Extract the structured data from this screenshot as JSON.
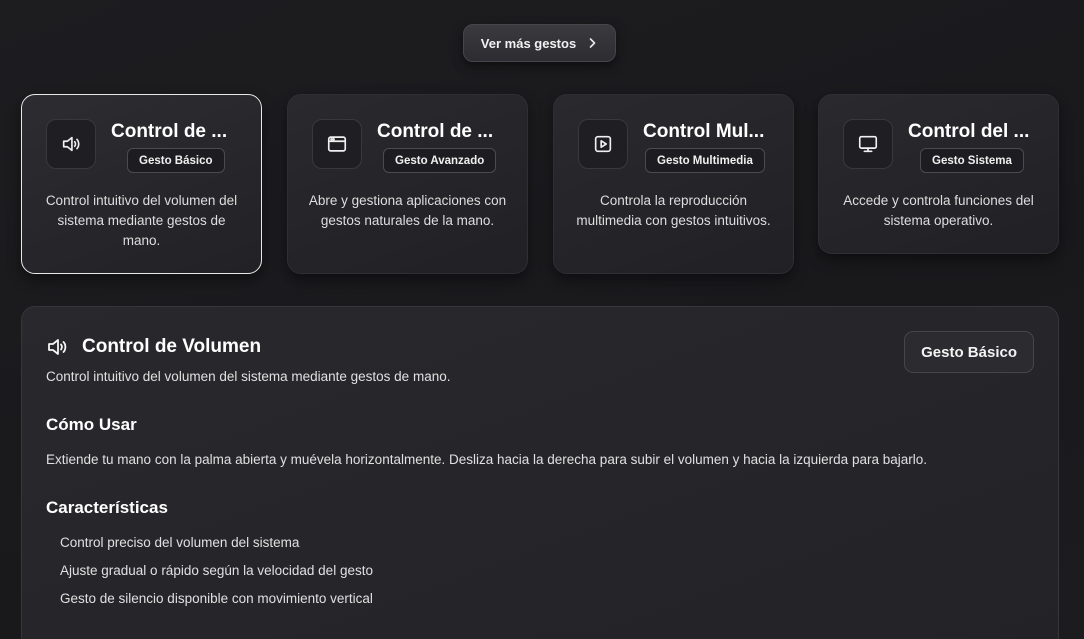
{
  "top_button": {
    "label": "Ver más gestos",
    "icon": "chevron-right-icon"
  },
  "cards": [
    {
      "title": "Control de ...",
      "badge": "Gesto Básico",
      "description": "Control intuitivo del volumen del sistema mediante gestos de mano.",
      "icon": "volume-icon",
      "selected": true
    },
    {
      "title": "Control de ...",
      "badge": "Gesto Avanzado",
      "description": "Abre y gestiona aplicaciones con gestos naturales de la mano.",
      "icon": "app-window-icon",
      "selected": false
    },
    {
      "title": "Control Mul...",
      "badge": "Gesto Multimedia",
      "description": "Controla la reproducción multimedia con gestos intuitivos.",
      "icon": "play-icon",
      "selected": false
    },
    {
      "title": "Control del ...",
      "badge": "Gesto Sistema",
      "description": "Accede y controla funciones del sistema operativo.",
      "icon": "monitor-icon",
      "selected": false
    }
  ],
  "detail": {
    "title": "Control de Volumen",
    "subtitle": "Control intuitivo del volumen del sistema mediante gestos de mano.",
    "badge": "Gesto Básico",
    "icon": "volume-icon",
    "how_to_heading": "Cómo Usar",
    "how_to_text": "Extiende tu mano con la palma abierta y muévela horizontalmente. Desliza hacia la derecha para subir el volumen y hacia la izquierda para bajarlo.",
    "features_heading": "Características",
    "features": [
      "Control preciso del volumen del sistema",
      "Ajuste gradual o rápido según la velocidad del gesto",
      "Gesto de silencio disponible con movimiento vertical"
    ]
  }
}
